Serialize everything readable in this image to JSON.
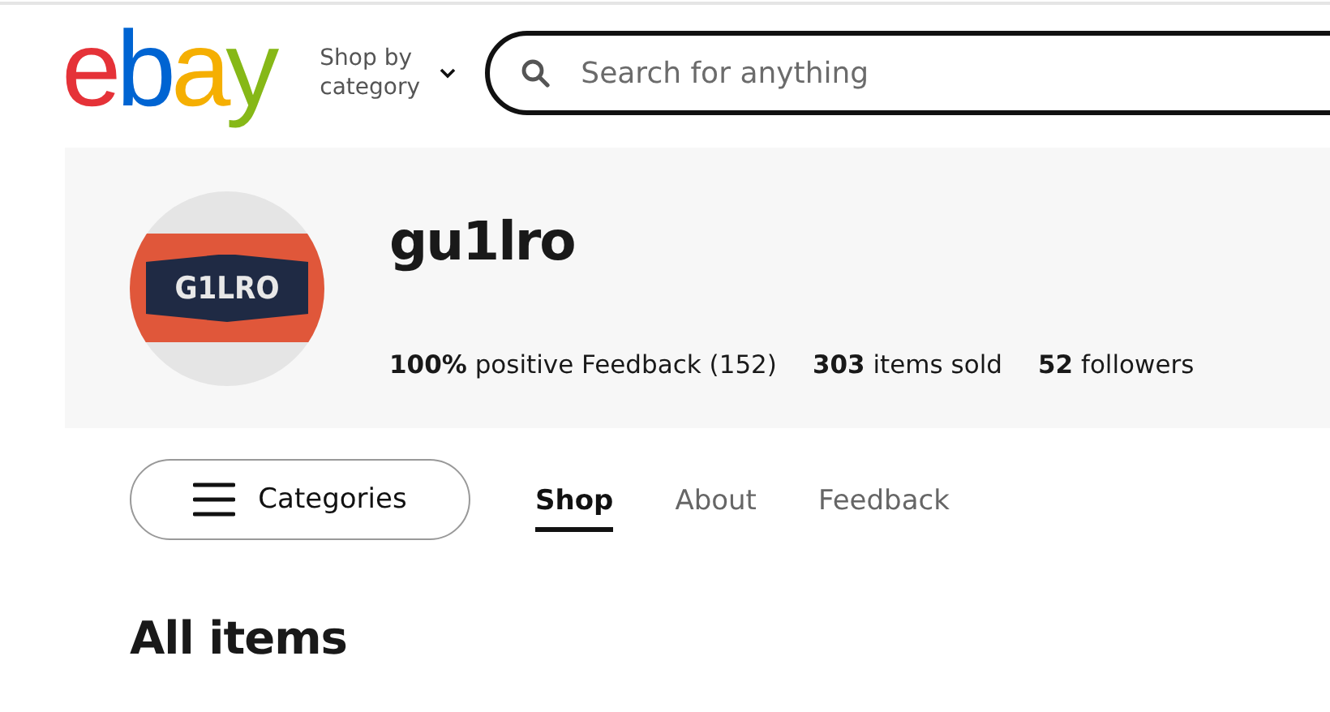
{
  "header": {
    "logo": "ebay",
    "shop_by_category": "Shop by category",
    "search": {
      "placeholder": "Search for anything"
    }
  },
  "seller": {
    "avatar_text": "G1LRO",
    "name": "gu1lro",
    "stats": [
      "**100%** positive Feedback (152)",
      "**303** items sold",
      "**52** followers"
    ]
  },
  "nav": {
    "categories_button": "Categories",
    "tabs": [
      {
        "label": "Shop",
        "selected": true
      },
      {
        "label": "About",
        "selected": false
      },
      {
        "label": "Feedback",
        "selected": false
      }
    ]
  },
  "section_title": "All items"
}
